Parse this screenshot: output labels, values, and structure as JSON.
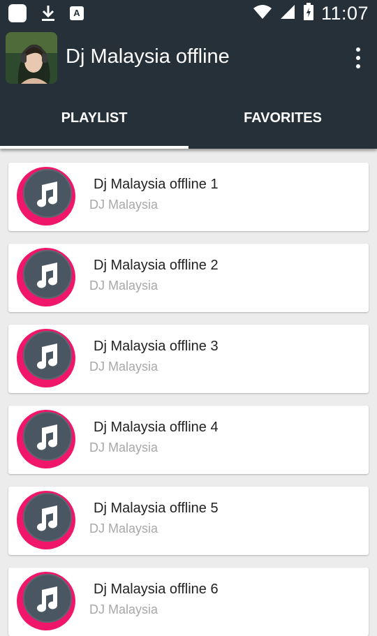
{
  "status_bar": {
    "time": "11:07",
    "icons": [
      "notification-square-icon",
      "download-icon",
      "app-a-icon",
      "wifi-icon",
      "signal-icon",
      "battery-icon"
    ]
  },
  "app_bar": {
    "title": "Dj Malaysia offline",
    "menu_icon": "overflow-menu-icon"
  },
  "tabs": [
    {
      "label": "PLAYLIST",
      "selected": true
    },
    {
      "label": "FAVORITES",
      "selected": false
    }
  ],
  "playlist": [
    {
      "title": "Dj Malaysia offline 1",
      "artist": "DJ Malaysia"
    },
    {
      "title": "Dj Malaysia offline 2",
      "artist": "DJ Malaysia"
    },
    {
      "title": "Dj Malaysia offline 3",
      "artist": "DJ Malaysia"
    },
    {
      "title": "Dj Malaysia offline 4",
      "artist": "DJ Malaysia"
    },
    {
      "title": "Dj Malaysia offline 5",
      "artist": "DJ Malaysia"
    },
    {
      "title": "Dj Malaysia offline 6",
      "artist": "DJ Malaysia"
    }
  ],
  "colors": {
    "app_bar": "#253038",
    "accent_ring": "#f0176a",
    "disc": "#4a5661"
  }
}
